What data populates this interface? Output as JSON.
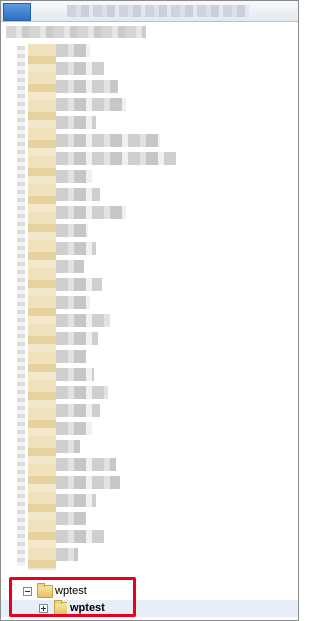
{
  "tree": {
    "nodes": [
      {
        "label": "wptest",
        "state": "expanded",
        "expander_icon": "minus-box-icon",
        "icon": "folder-icon",
        "bold": false
      },
      {
        "label": "wptest",
        "state": "collapsed",
        "expander_icon": "plus-box-icon",
        "icon": "folder-icon",
        "bold": true,
        "selected": true
      }
    ]
  },
  "colors": {
    "highlight_border": "#e8001f",
    "selection_background": "#e8eef7",
    "folder": "#e3c164"
  }
}
